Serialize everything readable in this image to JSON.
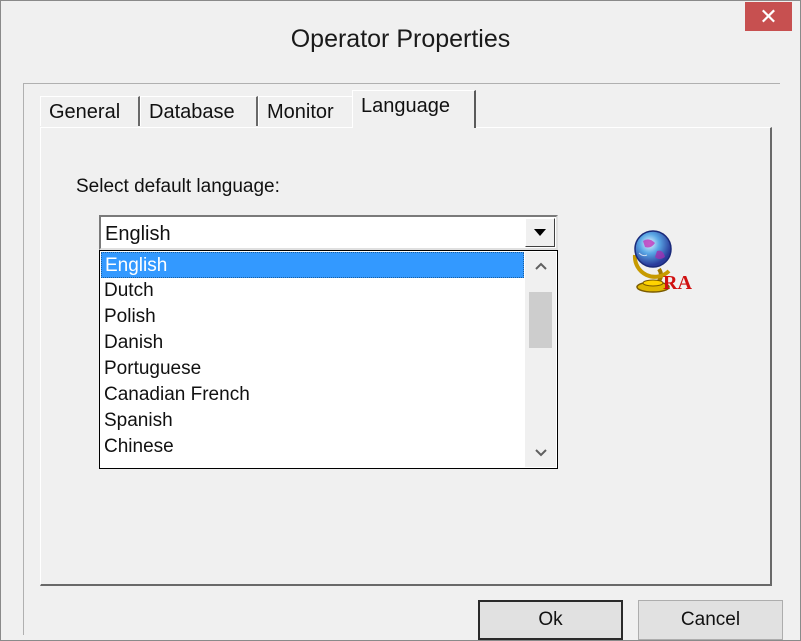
{
  "window": {
    "title": "Operator Properties",
    "close_glyph": "✕"
  },
  "tabs": [
    {
      "label": "General",
      "active": false
    },
    {
      "label": "Database",
      "active": false
    },
    {
      "label": "Monitor",
      "active": false
    },
    {
      "label": "Language",
      "active": true
    }
  ],
  "language_panel": {
    "prompt": "Select default language:",
    "combo_value": "English",
    "options": [
      "English",
      "Dutch",
      "Polish",
      "Danish",
      "Portuguese",
      "Canadian French",
      "Spanish",
      "Chinese"
    ],
    "selected_option": "English",
    "icon": "globe-icon"
  },
  "buttons": {
    "ok": "Ok",
    "cancel": "Cancel"
  },
  "colors": {
    "selection": "#3399ff",
    "close_button": "#c75050"
  }
}
